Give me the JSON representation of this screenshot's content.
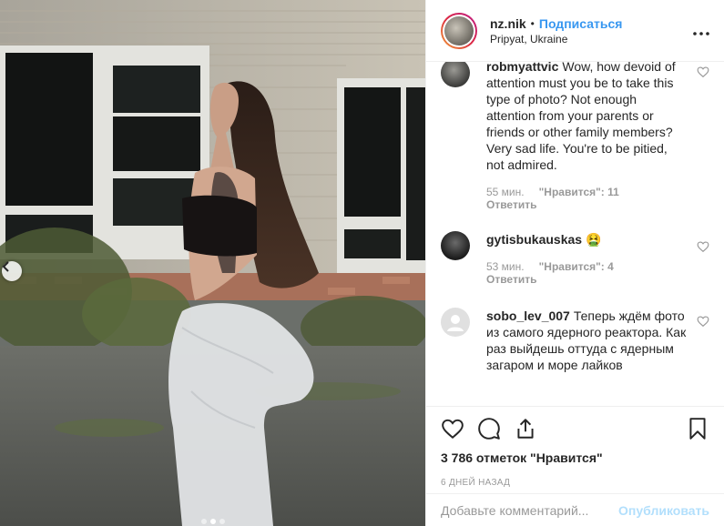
{
  "header": {
    "username": "nz.nik",
    "separator": "•",
    "follow_label": "Подписаться",
    "location": "Pripyat, Ukraine",
    "more_icon": "more-horizontal-icon"
  },
  "comments": [
    {
      "username": "robmyattvic",
      "text": "Wow, how devoid of attention must you be to take this type of photo? Not enough attention from your parents or friends or other family members? Very sad life. You're to be pitied, not admired.",
      "time": "55 мин.",
      "likes": "\"Нравится\": 11",
      "reply": "Ответить"
    },
    {
      "username": "gytisbukauskas",
      "text": "🤮",
      "time": "53 мин.",
      "likes": "\"Нравится\": 4",
      "reply": "Ответить"
    },
    {
      "username": "sobo_lev_007",
      "text": "Теперь ждём фото из самого ядерного реактора. Как раз выйдешь оттуда с ядерным загаром и море лайков"
    }
  ],
  "actions": {
    "like_icon": "heart-icon",
    "comment_icon": "comment-icon",
    "share_icon": "share-icon",
    "save_icon": "bookmark-icon"
  },
  "likes_count": "3 786 отметок \"Нравится\"",
  "posted_time": "6 ДНЕЙ НАЗАД",
  "add_comment": {
    "placeholder": "Добавьте комментарий...",
    "publish_label": "Опубликовать"
  },
  "carousel": {
    "prev_icon": "chevron-left-icon",
    "slides": 3,
    "active_slide": 1
  },
  "colors": {
    "link_blue": "#3897f0",
    "publish_disabled": "#b2dffc",
    "meta_gray": "#999999",
    "text": "#262626"
  }
}
